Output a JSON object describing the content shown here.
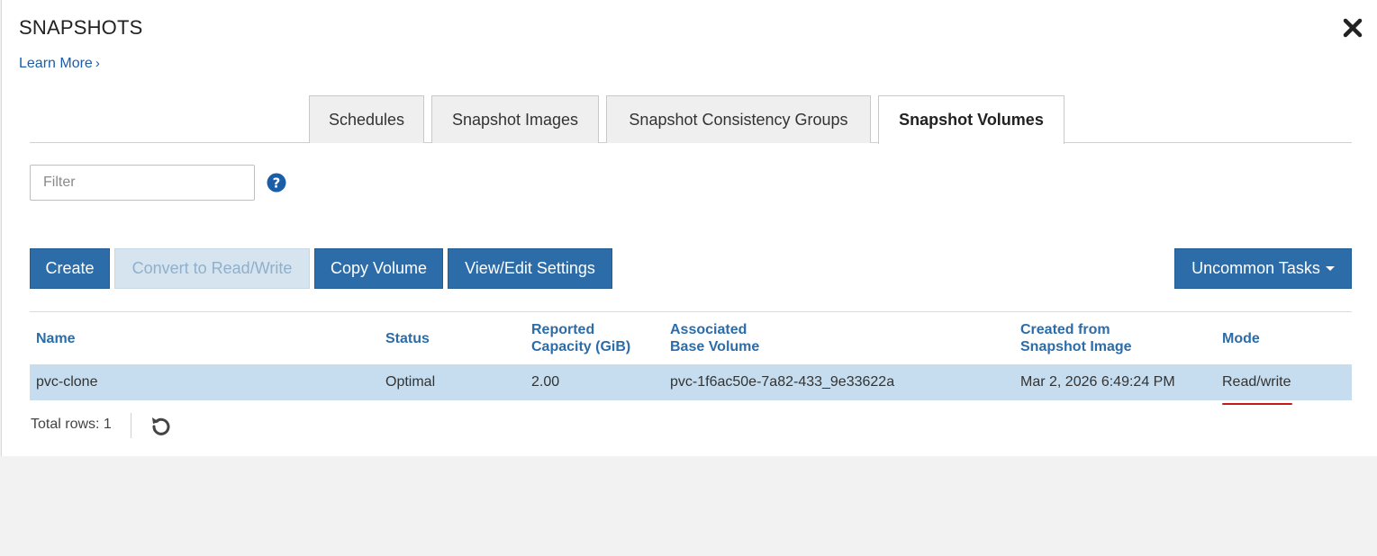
{
  "dialog": {
    "title": "SNAPSHOTS",
    "learn_more": "Learn More",
    "close_icon": "close-icon"
  },
  "tabs": [
    {
      "label": "Schedules",
      "active": false
    },
    {
      "label": "Snapshot Images",
      "active": false
    },
    {
      "label": "Snapshot Consistency Groups",
      "active": false
    },
    {
      "label": "Snapshot Volumes",
      "active": true
    }
  ],
  "filter": {
    "placeholder": "Filter",
    "value": ""
  },
  "toolbar": {
    "create": "Create",
    "convert": "Convert to Read/Write",
    "copy_volume": "Copy Volume",
    "view_edit": "View/Edit Settings",
    "uncommon_tasks": "Uncommon Tasks"
  },
  "table": {
    "columns": {
      "name": "Name",
      "status": "Status",
      "capacity_line1": "Reported",
      "capacity_line2": "Capacity (GiB)",
      "base_line1": "Associated",
      "base_line2": "Base Volume",
      "created_line1": "Created from",
      "created_line2": "Snapshot Image",
      "mode": "Mode"
    },
    "rows": [
      {
        "name": "pvc-clone",
        "status": "Optimal",
        "capacity": "2.00",
        "base_volume": "pvc-1f6ac50e-7a82-433_9e33622a",
        "created": "Mar 2, 2026 6:49:24 PM",
        "mode": "Read/write"
      }
    ]
  },
  "footer": {
    "total_rows": "Total rows: 1"
  },
  "colors": {
    "primary_button": "#2b6ca9",
    "selected_row": "#c5ddef",
    "link": "#1a5ea8",
    "annotation_underline": "#c61a1a"
  }
}
